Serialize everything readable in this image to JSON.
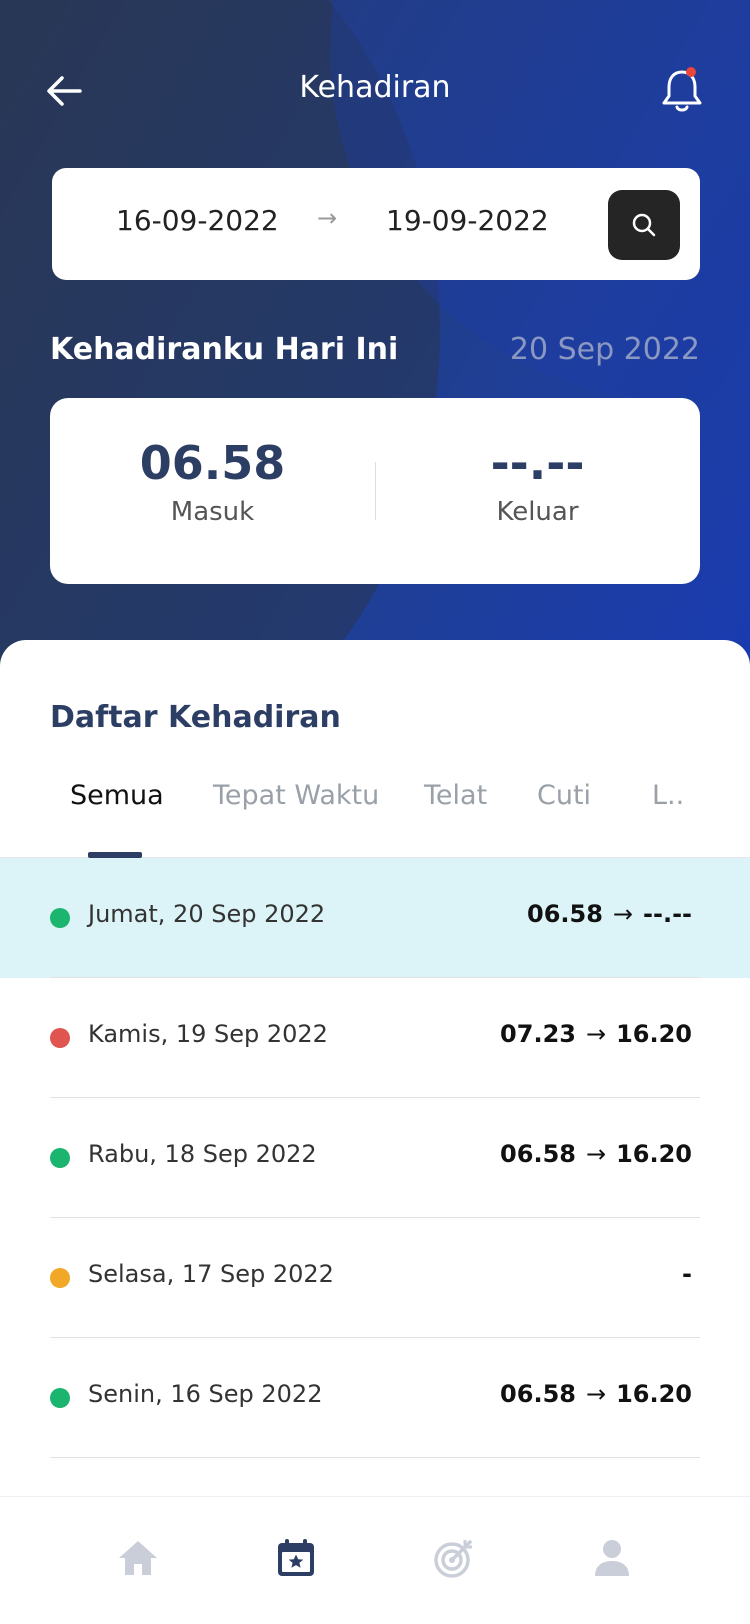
{
  "header": {
    "title": "Kehadiran"
  },
  "search": {
    "from_date": "16-09-2022",
    "to_date": "19-09-2022",
    "arrow": "→"
  },
  "today": {
    "title": "Kehadiranku Hari Ini",
    "date": "20 Sep 2022",
    "check_in_time": "06.58",
    "check_in_label": "Masuk",
    "check_out_time": "--.--",
    "check_out_label": "Keluar"
  },
  "list": {
    "title": "Daftar Kehadiran",
    "tabs": [
      {
        "label": "Semua"
      },
      {
        "label": "Tepat Waktu"
      },
      {
        "label": "Telat"
      },
      {
        "label": "Cuti"
      },
      {
        "label": "L.."
      }
    ],
    "arrow": "→",
    "rows": [
      {
        "date": "Jumat, 20 Sep 2022",
        "in": "06.58",
        "out": "--.--",
        "status_color": "#1bb56f"
      },
      {
        "date": "Kamis, 19 Sep 2022",
        "in": "07.23",
        "out": "16.20",
        "status_color": "#e0554f"
      },
      {
        "date": "Rabu, 18 Sep 2022",
        "in": "06.58",
        "out": "16.20",
        "status_color": "#1bb56f"
      },
      {
        "date": "Selasa, 17 Sep 2022",
        "value": "-",
        "status_color": "#f0a826"
      },
      {
        "date": "Senin, 16 Sep 2022",
        "in": "06.58",
        "out": "16.20",
        "status_color": "#1bb56f"
      }
    ]
  },
  "nav": [
    {
      "icon": "home-icon"
    },
    {
      "icon": "calendar-star-icon"
    },
    {
      "icon": "target-icon"
    },
    {
      "icon": "user-icon"
    }
  ],
  "colors": {
    "primary": "#2c3e63",
    "active_nav": "#2c3e63",
    "inactive_nav": "#c9ced8",
    "notification": "#e9463c"
  }
}
